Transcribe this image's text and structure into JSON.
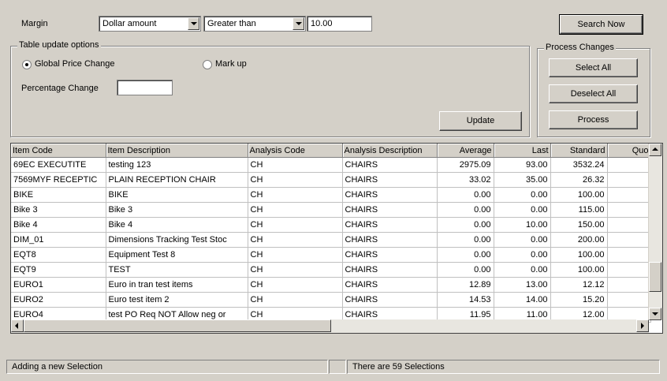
{
  "filter": {
    "margin_label": "Margin",
    "type_value": "Dollar amount",
    "operator_value": "Greater than",
    "amount_value": "10.00",
    "search_label": "Search Now"
  },
  "table_update": {
    "legend": "Table update options",
    "global_label": "Global Price Change",
    "markup_label": "Mark up",
    "percentage_label": "Percentage Change",
    "percentage_value": "",
    "update_label": "Update"
  },
  "process": {
    "legend": "Process Changes",
    "select_all": "Select All",
    "deselect_all": "Deselect All",
    "process_label": "Process"
  },
  "grid": {
    "columns": [
      "Item Code",
      "Item Description",
      "Analysis Code",
      "Analysis Description",
      "Average",
      "Last",
      "Standard",
      "Quo"
    ],
    "rows": [
      [
        "69EC EXECUTITE",
        "testing 123",
        "CH",
        "CHAIRS",
        "2975.09",
        "93.00",
        "3532.24",
        ""
      ],
      [
        "7569MYF RECEPTIC",
        "PLAIN RECEPTION CHAIR",
        "CH",
        "CHAIRS",
        "33.02",
        "35.00",
        "26.32",
        ""
      ],
      [
        "BIKE",
        "BIKE",
        "CH",
        "CHAIRS",
        "0.00",
        "0.00",
        "100.00",
        ""
      ],
      [
        "Bike 3",
        "Bike 3",
        "CH",
        "CHAIRS",
        "0.00",
        "0.00",
        "115.00",
        ""
      ],
      [
        "Bike 4",
        "Bike 4",
        "CH",
        "CHAIRS",
        "0.00",
        "10.00",
        "150.00",
        ""
      ],
      [
        "DIM_01",
        "Dimensions Tracking Test Stoc",
        "CH",
        "CHAIRS",
        "0.00",
        "0.00",
        "200.00",
        ""
      ],
      [
        "EQT8",
        "Equipment Test 8",
        "CH",
        "CHAIRS",
        "0.00",
        "0.00",
        "100.00",
        ""
      ],
      [
        "EQT9",
        "TEST",
        "CH",
        "CHAIRS",
        "0.00",
        "0.00",
        "100.00",
        ""
      ],
      [
        "EURO1",
        "Euro in tran test items",
        "CH",
        "CHAIRS",
        "12.89",
        "13.00",
        "12.12",
        ""
      ],
      [
        "EURO2",
        "Euro test item 2",
        "CH",
        "CHAIRS",
        "14.53",
        "14.00",
        "15.20",
        ""
      ],
      [
        "EURO4",
        "test PO Req NOT Allow neg or",
        "CH",
        "CHAIRS",
        "11.95",
        "11.00",
        "12.00",
        ""
      ]
    ]
  },
  "statusbar": {
    "left": "Adding a new Selection",
    "right": "There are 59 Selections"
  }
}
